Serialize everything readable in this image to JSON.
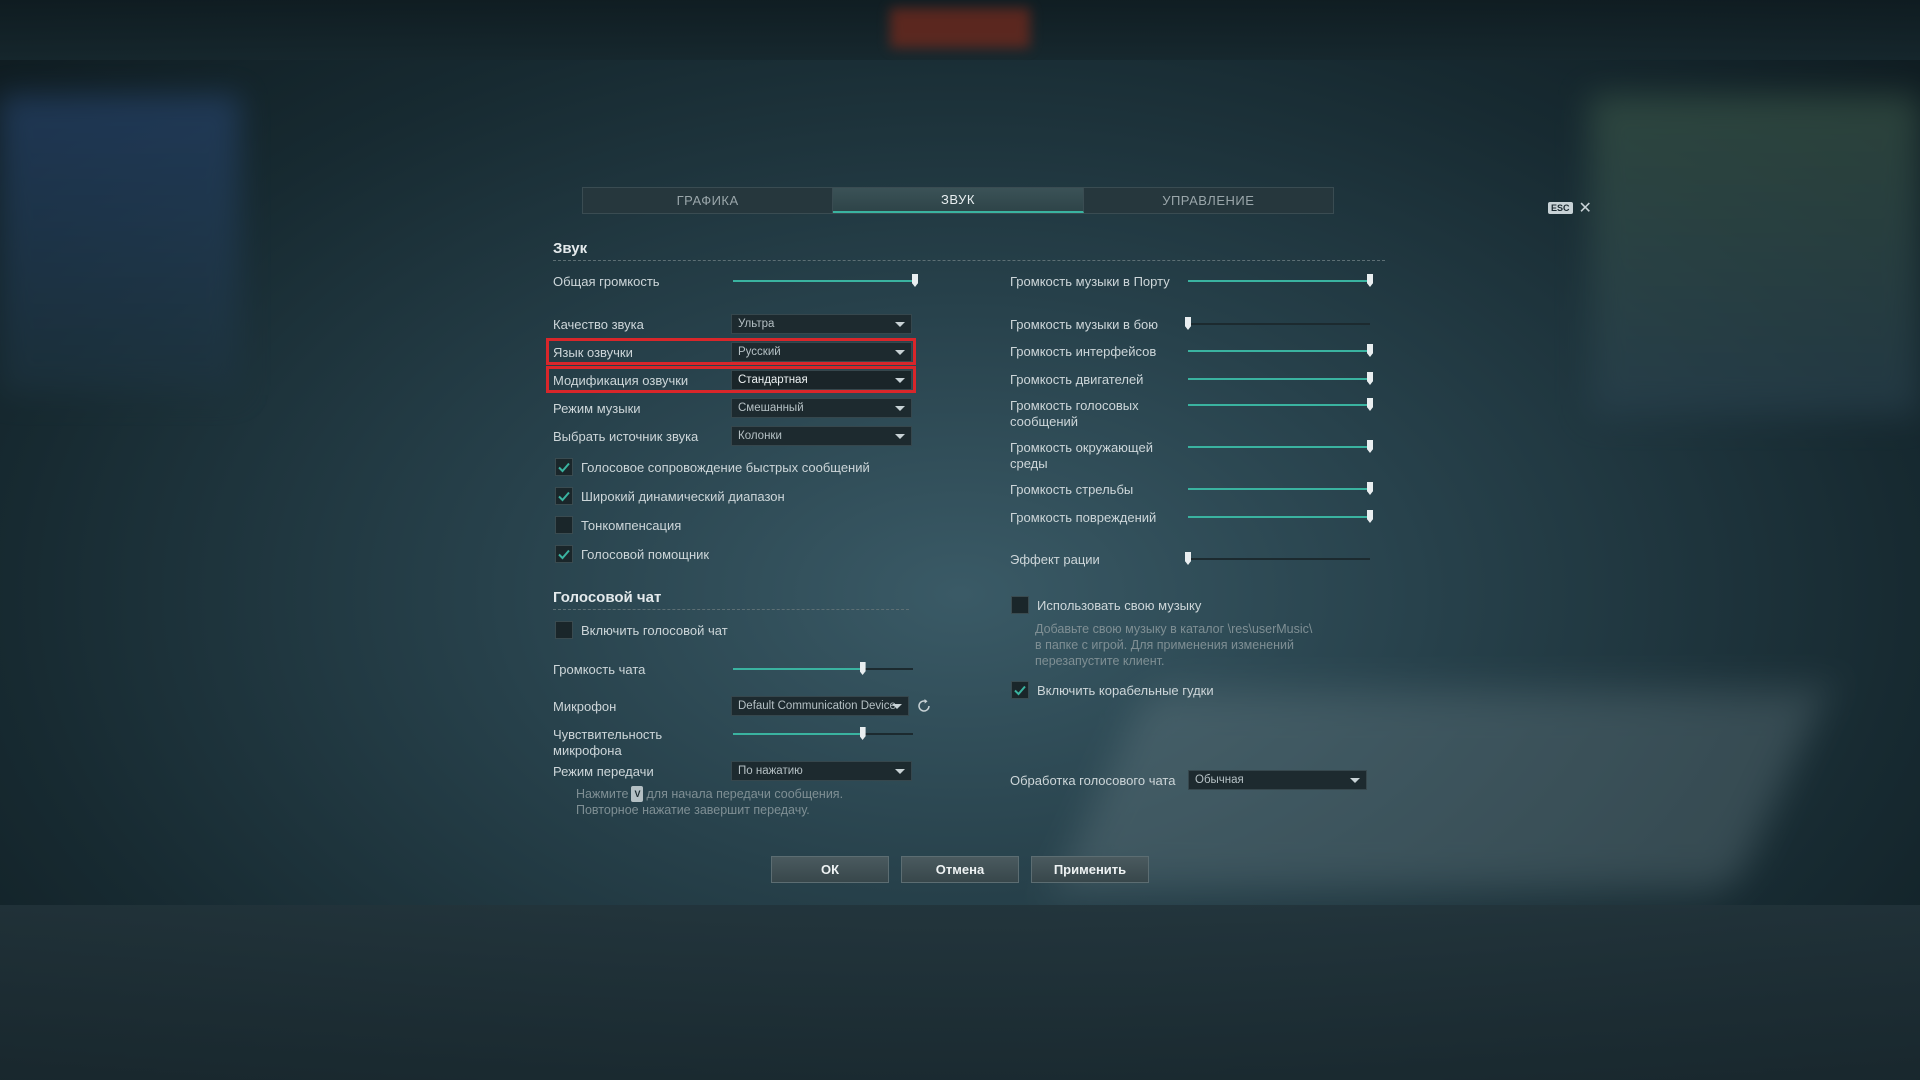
{
  "tabs": [
    {
      "label": "ГРАФИКА",
      "active": false
    },
    {
      "label": "ЗВУК",
      "active": true
    },
    {
      "label": "УПРАВЛЕНИЕ",
      "active": false
    }
  ],
  "esc_label": "ESC",
  "sound": {
    "title": "Звук",
    "master_volume": {
      "label": "Общая громкость",
      "value": 1.0
    },
    "quality": {
      "label": "Качество звука",
      "value": "Ультра"
    },
    "voice_language": {
      "label": "Язык озвучки",
      "value": "Русский"
    },
    "voice_mod": {
      "label": "Модификация озвучки",
      "value": "Стандартная"
    },
    "music_mode": {
      "label": "Режим музыки",
      "value": "Смешанный"
    },
    "sound_source": {
      "label": "Выбрать источник звука",
      "value": "Колонки"
    },
    "checkboxes": [
      {
        "label": "Голосовое сопровождение быстрых сообщений",
        "checked": true
      },
      {
        "label": "Широкий динамический диапазон",
        "checked": true
      },
      {
        "label": "Тонкомпенсация",
        "checked": false
      },
      {
        "label": "Голосовой помощник",
        "checked": true
      }
    ]
  },
  "voice_chat": {
    "title": "Голосовой чат",
    "enable": {
      "label": "Включить голосовой чат",
      "checked": false
    },
    "chat_volume": {
      "label": "Громкость чата",
      "value": 0.72
    },
    "microphone": {
      "label": "Микрофон",
      "value": "Default Communication Device"
    },
    "mic_sensitivity": {
      "label": "Чувствительность микрофона",
      "value": 0.72
    },
    "transmit_mode": {
      "label": "Режим передачи",
      "value": "По нажатию"
    },
    "hint_before_key": "Нажмите",
    "hint_key": "V",
    "hint_after_key": "для начала передачи сообщения.",
    "hint_line2": "Повторное нажатие завершит передачу.",
    "processing": {
      "label": "Обработка голосового чата",
      "value": "Обычная"
    }
  },
  "right_sliders": [
    {
      "label": "Громкость музыки в Порту",
      "value": 1.0
    },
    {
      "label": "Громкость музыки в бою",
      "value": 0.0
    },
    {
      "label": "Громкость интерфейсов",
      "value": 1.0
    },
    {
      "label": "Громкость двигателей",
      "value": 1.0
    },
    {
      "label": "Громкость голосовых сообщений",
      "value": 1.0
    },
    {
      "label": "Громкость окружающей среды",
      "value": 1.0
    },
    {
      "label": "Громкость стрельбы",
      "value": 1.0
    },
    {
      "label": "Громкость повреждений",
      "value": 1.0
    },
    {
      "label": "Эффект рации",
      "value": 0.0
    }
  ],
  "user_music": {
    "label": "Использовать свою музыку",
    "checked": false,
    "hint_lines": [
      "Добавьте свою музыку в каталог \\res\\userMusic\\",
      "в папке с игрой. Для применения изменений",
      "перезапустите клиент."
    ]
  },
  "ship_horns": {
    "label": "Включить корабельные гудки",
    "checked": true
  },
  "buttons": {
    "ok": "ОК",
    "cancel": "Отмена",
    "apply": "Применить"
  },
  "colors": {
    "accent": "#3ab3a0",
    "highlight": "#d9262a"
  }
}
